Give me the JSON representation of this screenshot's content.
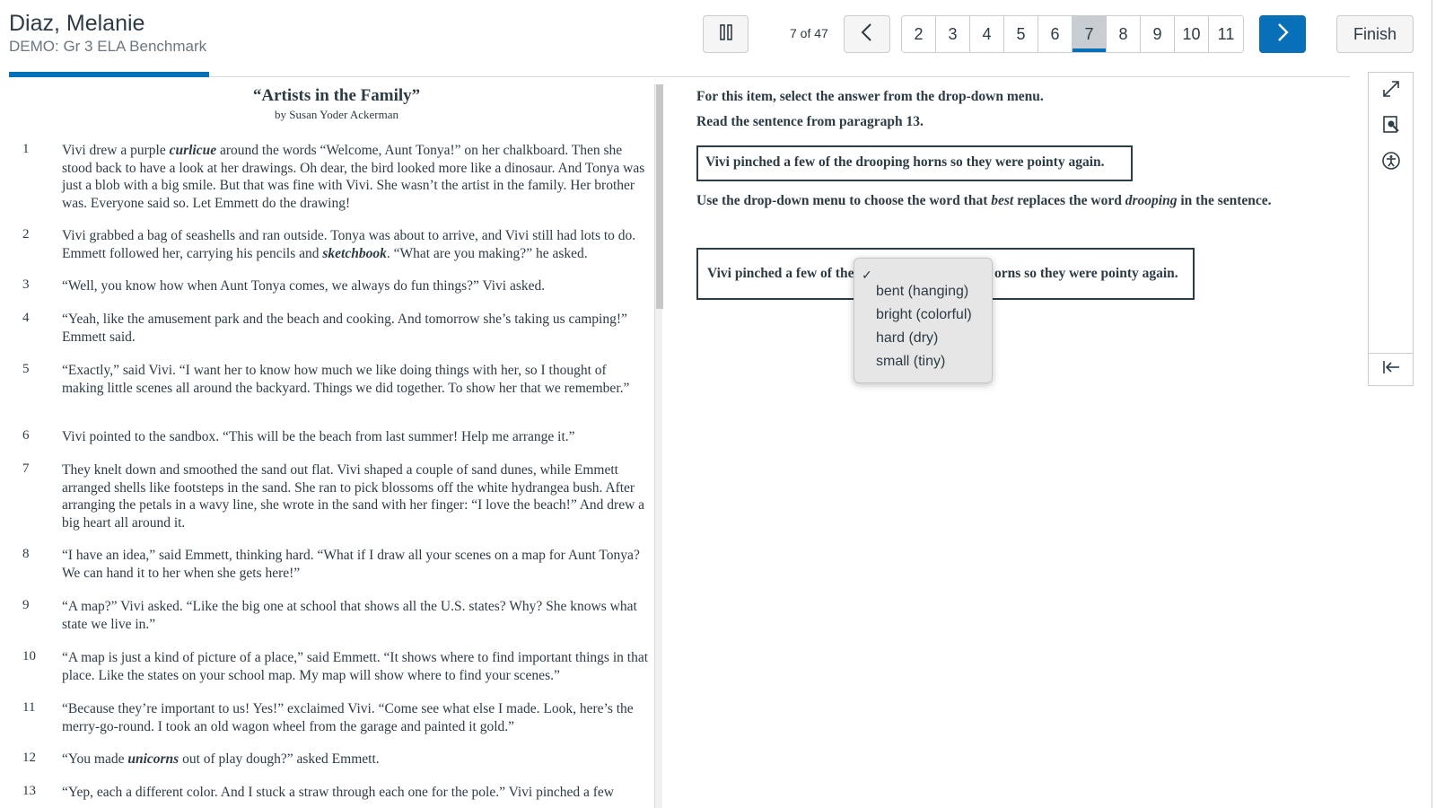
{
  "header": {
    "student_name": "Diaz, Melanie",
    "test_name": "DEMO: Gr 3 ELA Benchmark",
    "page_count": "7 of 47",
    "pages": [
      "2",
      "3",
      "4",
      "5",
      "6",
      "7",
      "8",
      "9",
      "10",
      "11"
    ],
    "current_page": "7",
    "finish_label": "Finish",
    "progress_fraction": 0.149
  },
  "passage": {
    "title": "“Artists in the Family”",
    "author": "by Susan Yoder Ackerman",
    "paragraphs": [
      {
        "num": "1",
        "text": "Vivi drew a purple curlicue around the words “Welcome, Aunt Tonya!” on her chalkboard. Then she stood back to have a look at her drawings. Oh dear, the bird looked more like a dinosaur. And Tonya was just a blob with a big smile. But that was fine with Vivi. She wasn’t the artist in the family. Her brother was. Everyone said so. Let Emmett do the drawing!"
      },
      {
        "num": "2",
        "text": "Vivi grabbed a bag of seashells and ran outside. Tonya was about to arrive, and Vivi still had lots to do. Emmett followed her, carrying his pencils and sketchbook. “What are you making?” he asked."
      },
      {
        "num": "3",
        "text": "“Well, you know how when Aunt Tonya comes, we always do fun things?” Vivi asked."
      },
      {
        "num": "4",
        "text": "“Yeah, like the amusement park and the beach and cooking. And tomorrow she’s taking us camping!” Emmett said."
      },
      {
        "num": "5",
        "text": "“Exactly,” said Vivi. “I want her to know how much we like doing things with her, so I thought of making little scenes all around the backyard. Things we did together. To show her that we remember.”"
      },
      {
        "num": "6",
        "text": "Vivi pointed to the sandbox. “This will be the beach from last summer! Help me arrange it.”"
      },
      {
        "num": "7",
        "text": "They knelt down and smoothed the sand out flat. Vivi shaped a couple of sand dunes, while Emmett arranged shells like footsteps in the sand. She ran to pick blossoms off the white hydrangea bush. After arranging the petals in a wavy line, she wrote in the sand with her finger: “I love the beach!” And drew a big heart all around it."
      },
      {
        "num": "8",
        "text": "“I have an idea,” said Emmett, thinking hard. “What if I draw all your scenes on a map for Aunt Tonya? We can hand it to her when she gets here!”"
      },
      {
        "num": "9",
        "text": "“A map?” Vivi asked. “Like the big one at school that shows all the U.S. states? Why? She knows what state we live in.”"
      },
      {
        "num": "10",
        "text": "“A map is just a kind of picture of a place,” said Emmett. “It shows where to find important things in that place. Like the states on your school map. My map will show where to find your scenes.”"
      },
      {
        "num": "11",
        "text": "“Because they’re important to us! Yes!” exclaimed Vivi. “Come see what else I made. Look, here’s the merry-go-round. I took an old wagon wheel from the garage and painted it gold.”"
      },
      {
        "num": "12",
        "text": "“You made unicorns out of play dough?” asked Emmett."
      },
      {
        "num": "13",
        "text": "“Yep, each a different color. And I stuck a straw through each one for the pole.” Vivi pinched a few"
      }
    ]
  },
  "question": {
    "instruction": "For this item, select the answer from the drop-down menu.",
    "read_prompt": "Read the sentence from paragraph 13.",
    "sentence": "Vivi pinched a few of the drooping horns so they were pointy again.",
    "use_prefix": "Use the drop-down menu to choose the word that ",
    "use_best": "best",
    "use_middle": " replaces the word ",
    "use_word": "drooping",
    "use_suffix": " in the sentence.",
    "answer_pre": "Vivi pinched a few of the",
    "answer_post": "orns so they were pointy again."
  },
  "dropdown": {
    "check": "✓",
    "options": [
      "bent (hanging)",
      "bright (colorful)",
      "hard (dry)",
      "small (tiny)"
    ]
  },
  "icons": {
    "pause": "pause-icon",
    "prev": "chevron-left-icon",
    "next": "chevron-right-icon",
    "expand": "expand-icon",
    "magnifier": "magnifier-icon",
    "accessibility": "accessibility-icon",
    "collapse": "collapse-panel-icon"
  },
  "colors": {
    "accent": "#0770b8",
    "text": "#2d3b45",
    "muted": "#6b7780",
    "border": "#c7cdd1"
  }
}
